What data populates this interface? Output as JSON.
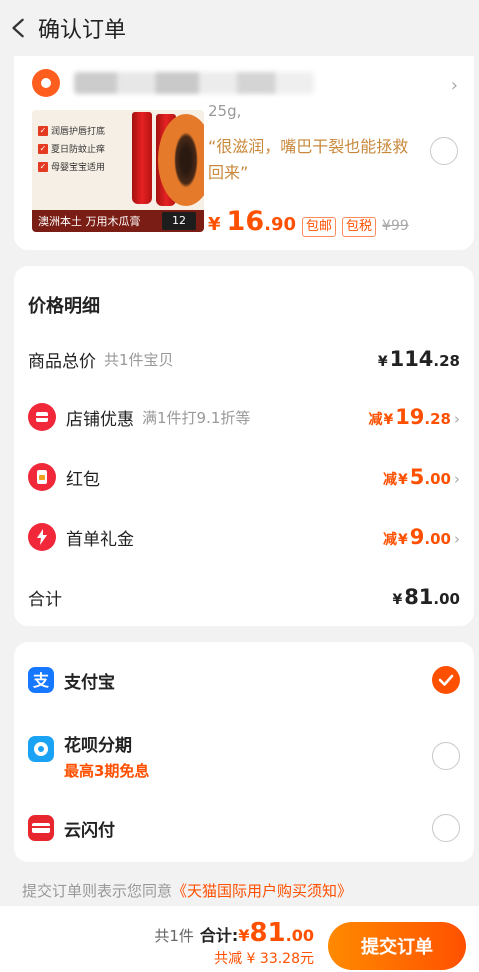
{
  "header": {
    "title": "确认订单"
  },
  "store": {
    "name_hidden": ""
  },
  "product": {
    "image_features": [
      "润唇护唇打底",
      "夏日防蚊止痒",
      "母婴宝宝适用"
    ],
    "image_tag": "澳洲本土 万用木瓜膏",
    "image_tag_count": "12",
    "spec": "25g,",
    "quote": "“很滋润，嘴巴干裂也能拯救回来”",
    "price_yen": "¥",
    "price_int": "16",
    "price_dec": ".90",
    "tag_free_ship": "包邮",
    "tag_tax_incl": "包税",
    "orig_price": "¥99"
  },
  "detail": {
    "title": "价格明细",
    "rows": [
      {
        "label": "商品总价",
        "sub": "共1件宝贝",
        "minus": "",
        "yen": "¥",
        "int": "114",
        "dec": ".28"
      },
      {
        "label": "店铺优惠",
        "sub": "满1件打9.1折等",
        "minus": "减",
        "yen": "¥",
        "int": "19",
        "dec": ".28"
      },
      {
        "label": "红包",
        "sub": "",
        "minus": "减",
        "yen": "¥",
        "int": "5",
        "dec": ".00"
      },
      {
        "label": "首单礼金",
        "sub": "",
        "minus": "减",
        "yen": "¥",
        "int": "9",
        "dec": ".00"
      },
      {
        "label": "合计",
        "sub": "",
        "minus": "",
        "yen": "¥",
        "int": "81",
        "dec": ".00"
      }
    ]
  },
  "payment": {
    "methods": [
      {
        "name": "支付宝",
        "sub": "",
        "selected": true
      },
      {
        "name": "花呗分期",
        "sub": "最高3期免息",
        "selected": false
      },
      {
        "name": "云闪付",
        "sub": "",
        "selected": false
      }
    ]
  },
  "agreement": {
    "prefix": "提交订单则表示您同意",
    "link": "《天猫国际用户购买须知》"
  },
  "bottom": {
    "count": "共1件",
    "total_label": "合计:",
    "yen": "¥",
    "int": "81",
    "dec": ".00",
    "saved": "共减 ¥ 33.28元",
    "submit": "提交订单"
  },
  "colors": {
    "accent": "#ff5000",
    "quote": "#c9893d",
    "bg": "#f2f2f2"
  }
}
